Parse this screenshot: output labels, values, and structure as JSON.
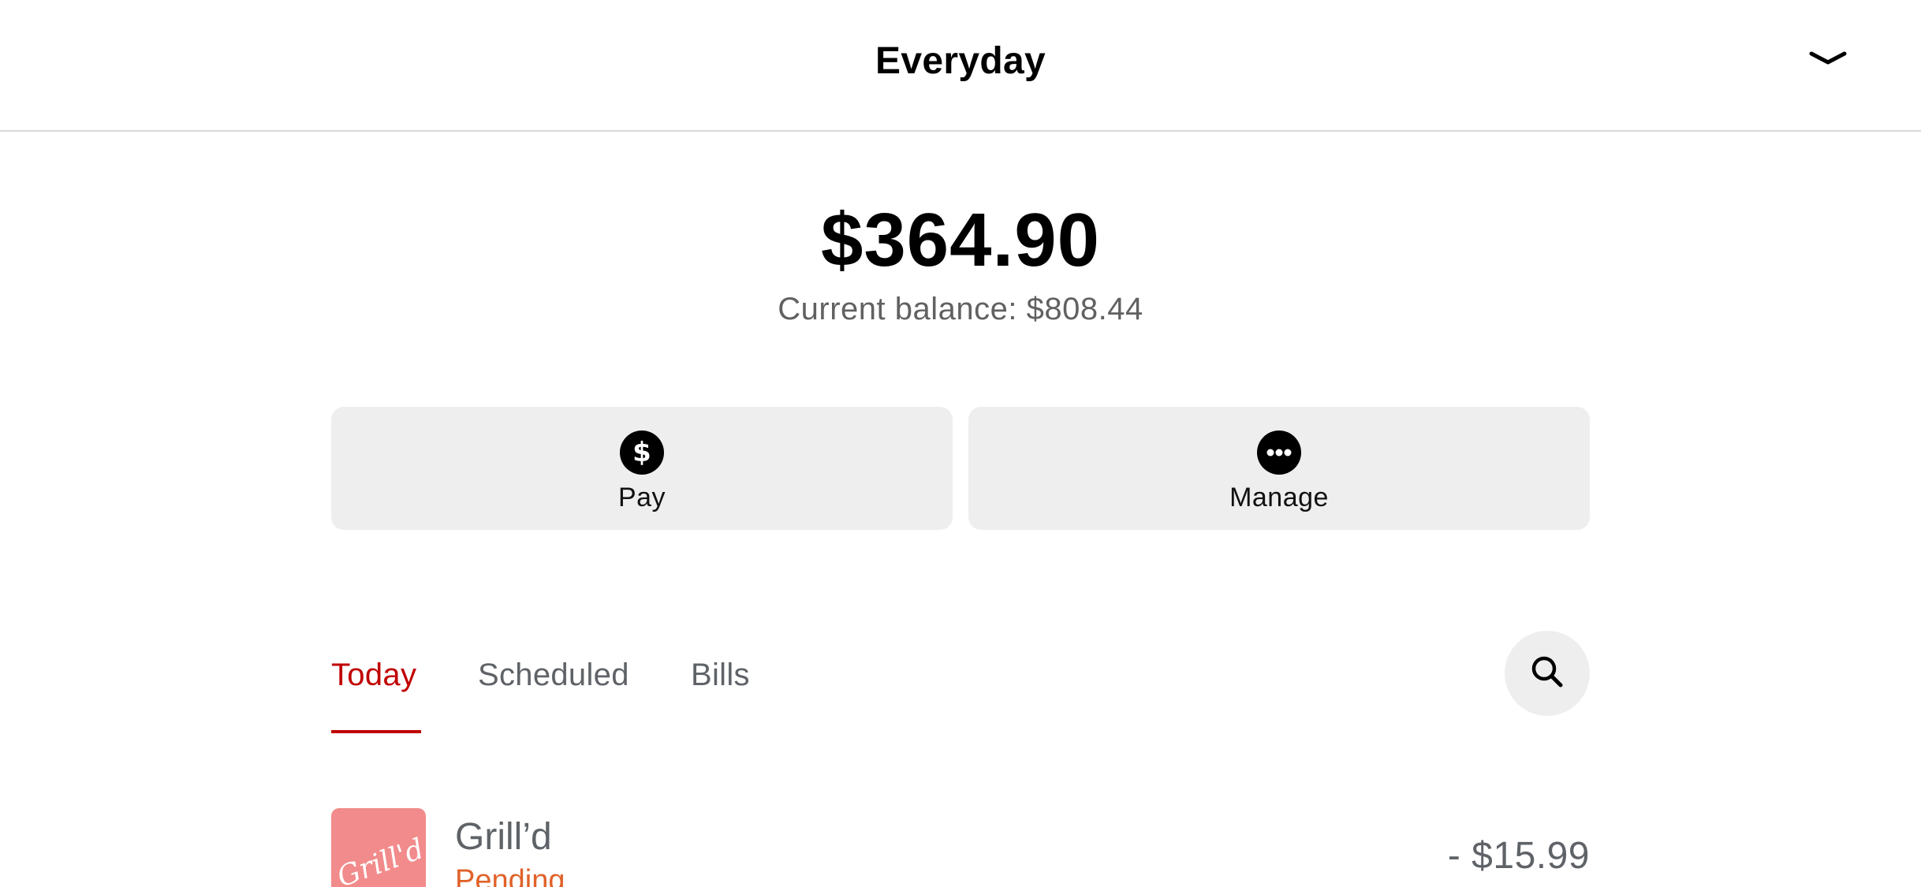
{
  "header": {
    "title": "Everyday",
    "collapse_icon": "chevron-down-icon"
  },
  "account": {
    "available_balance": "$364.90",
    "current_balance_text": "Current balance: $808.44"
  },
  "actions": [
    {
      "label": "Pay",
      "icon": "dollar-circle-icon"
    },
    {
      "label": "Manage",
      "icon": "more-circle-icon"
    }
  ],
  "tabs": {
    "items": [
      {
        "label": "Today",
        "active": true
      },
      {
        "label": "Scheduled",
        "active": false
      },
      {
        "label": "Bills",
        "active": false
      }
    ],
    "active_color": "#c00000",
    "search_icon": "search-icon"
  },
  "transactions": [
    {
      "merchant": "Grill’d",
      "logo_text": "Grill'd",
      "status": "Pending",
      "amount": "- $15.99",
      "logo_color": "#f28b8b"
    }
  ]
}
